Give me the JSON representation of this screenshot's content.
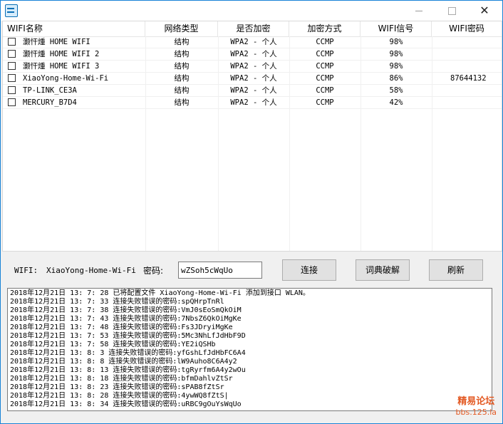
{
  "table": {
    "headers": [
      "WIFI名称",
      "网络类型",
      "是否加密",
      "加密方式",
      "WIFI信号",
      "WIFI密码"
    ],
    "rows": [
      {
        "ssid": "灏忓煄 HOME WIFI",
        "type": "结构",
        "security": "WPA2 - 个人",
        "cipher": "CCMP",
        "signal": "98%",
        "password": ""
      },
      {
        "ssid": "灏忓煄 HOME WIFI 2",
        "type": "结构",
        "security": "WPA2 - 个人",
        "cipher": "CCMP",
        "signal": "98%",
        "password": ""
      },
      {
        "ssid": "灏忓煄 HOME WIFI 3",
        "type": "结构",
        "security": "WPA2 - 个人",
        "cipher": "CCMP",
        "signal": "98%",
        "password": ""
      },
      {
        "ssid": "XiaoYong-Home-Wi-Fi",
        "type": "结构",
        "security": "WPA2 - 个人",
        "cipher": "CCMP",
        "signal": "86%",
        "password": "87644132"
      },
      {
        "ssid": "TP-LINK_CE3A",
        "type": "结构",
        "security": "WPA2 - 个人",
        "cipher": "CCMP",
        "signal": "58%",
        "password": ""
      },
      {
        "ssid": "MERCURY_B7D4",
        "type": "结构",
        "security": "WPA2 - 个人",
        "cipher": "CCMP",
        "signal": "42%",
        "password": ""
      }
    ]
  },
  "controls": {
    "wifi_label": "WIFI:",
    "wifi_value": "XiaoYong-Home-Wi-Fi",
    "password_label": "密码:",
    "password_value": "wZSoh5cWqUo",
    "connect_label": "连接",
    "dict_crack_label": "词典破解",
    "refresh_label": "刷新"
  },
  "log": [
    "2018年12月21日 13: 7: 28 已将配置文件 XiaoYong-Home-Wi-Fi 添加到接口 WLAN。",
    "2018年12月21日 13: 7: 33 连接失败错误的密码:spQHrpTnRl",
    "2018年12月21日 13: 7: 38 连接失败错误的密码:VmJ0sEoSmQkOiM",
    "2018年12月21日 13: 7: 43 连接失败错误的密码:7NbsZ6QkOiMgKe",
    "2018年12月21日 13: 7: 48 连接失败错误的密码:Fs3JDryiMgKe",
    "2018年12月21日 13: 7: 53 连接失败错误的密码:5Mc3NhLfJdHbF9D",
    "2018年12月21日 13: 7: 58 连接失败错误的密码:YE2iQSHb",
    "2018年12月21日 13: 8: 3 连接失败错误的密码:yfGshLfJdHbFC6A4",
    "2018年12月21日 13: 8: 8 连接失败错误的密码:lW9Auho8C6A4y2",
    "2018年12月21日 13: 8: 13 连接失败错误的密码:tgRyrfm6A4y2wOu",
    "2018年12月21日 13: 8: 18 连接失败错误的密码:bfmDahlvZtSr",
    "2018年12月21日 13: 8: 23 连接失败错误的密码:sPAB8fZtSr",
    "2018年12月21日 13: 8: 28 连接失败错误的密码:4ywWQ8fZtS|",
    "2018年12月21日 13: 8: 34 连接失败错误的密码:uRBC9gOuYsWqUo"
  ],
  "watermark": {
    "title": "精易论坛",
    "url": "bbs.125.la"
  },
  "colors": {
    "window_border": "#1883d7",
    "watermark": "#e35a24"
  }
}
